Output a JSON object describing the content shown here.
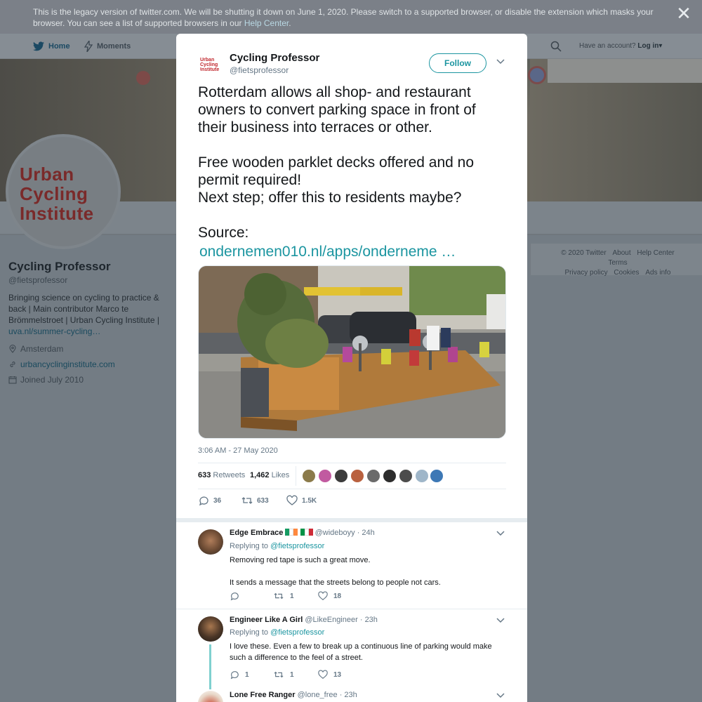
{
  "legacy_banner": {
    "text": "This is the legacy version of twitter.com. We will be shutting it down on June 1, 2020. Please switch to a supported browser, or disable the extension which masks your browser. You can see a list of supported browsers in our",
    "link": "Help Center",
    "end": "."
  },
  "nav": {
    "home": "Home",
    "moments": "Moments",
    "account_prompt": "Have an account?",
    "login": "Log in"
  },
  "profile": {
    "logo_lines": [
      "Urban",
      "Cycling",
      "Institute"
    ],
    "name": "Cycling Professor",
    "handle": "@fietsprofessor",
    "bio": "Bringing science on cycling to practice & back | Main contributor Marco te Brömmelstroet | Urban Cycling Institute |",
    "bio_link": "uva.nl/summer-cycling…",
    "location": "Amsterdam",
    "website": "urbancyclinginstitute.com",
    "joined": "Joined July 2010"
  },
  "footer": {
    "items": [
      "© 2020 Twitter",
      "About",
      "Help Center",
      "Terms",
      "Privacy policy",
      "Cookies",
      "Ads info"
    ]
  },
  "tweet": {
    "name": "Cycling Professor",
    "handle": "@fietsprofessor",
    "follow_label": "Follow",
    "text": "Rotterdam allows all shop- and restaurant owners to convert parking space in front of their business into terraces or other.\n\nFree wooden parklet decks offered and no permit required!\nNext step; offer this to residents maybe?\n\nSource:",
    "link": "ondernemen010.nl/apps/onderneme   …",
    "date": "3:06 AM - 27 May 2020",
    "retweets_count": "633",
    "retweets_label": "Retweets",
    "likes_count": "1,462",
    "likes_label": "Likes",
    "reply_count": "36",
    "retweet_action_count": "633",
    "like_action_count": "1.5K"
  },
  "replies": [
    {
      "name": "Edge Embrace",
      "handle": "@wideboyy",
      "time": "· 24h",
      "replying_label": "Replying to",
      "replying_to": "@fietsprofessor",
      "body": "Removing red tape is such a great move.\n\nIt sends a message that the streets belong to people not cars.",
      "retweets": "1",
      "likes": "18"
    },
    {
      "name": "Engineer Like A Girl",
      "handle": "@LikeEngineer",
      "time": "· 23h",
      "replying_label": "Replying to",
      "replying_to": "@fietsprofessor",
      "body": "I love these. Even a few to break up a continuous line of parking would make such a difference to the feel of a street.",
      "replies": "1",
      "retweets": "1",
      "likes": "13"
    },
    {
      "name": "Lone Free Ranger",
      "handle": "@lone_free",
      "time": "· 23h"
    }
  ],
  "colors": {
    "accent": "#1b95a0",
    "text": "#14171a",
    "muted": "#657786",
    "overlay_bg": "#737c84"
  }
}
